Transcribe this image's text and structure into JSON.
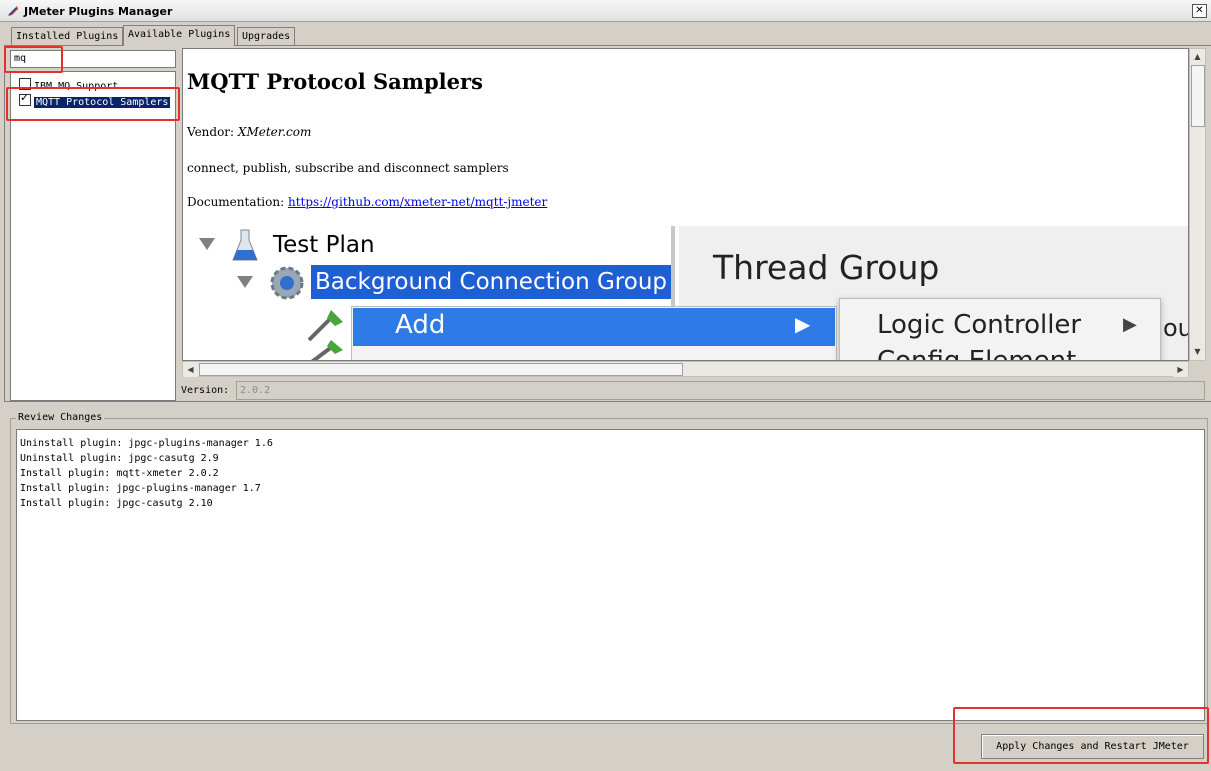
{
  "window": {
    "title": "JMeter Plugins Manager",
    "close_glyph": "✕"
  },
  "tabs": [
    {
      "label": "Installed Plugins",
      "active": false
    },
    {
      "label": "Available Plugins",
      "active": true
    },
    {
      "label": "Upgrades",
      "active": false
    }
  ],
  "search": {
    "value": "mq"
  },
  "plugins": [
    {
      "label": "IBM MQ Support",
      "checked": false,
      "selected": false
    },
    {
      "label": "MQTT Protocol Samplers",
      "checked": true,
      "selected": true
    }
  ],
  "detail": {
    "title": "MQTT Protocol Samplers",
    "vendor_label": "Vendor:",
    "vendor": "XMeter.com",
    "description": "connect, publish, subscribe and disconnect samplers",
    "doc_label": "Documentation:",
    "doc_link": "https://github.com/xmeter-net/mqtt-jmeter"
  },
  "embedded_image": {
    "tree_root": "Test Plan",
    "tree_child": "Background Connection Group",
    "panel_title": "Thread Group",
    "menu_add": "Add",
    "submenu_1": "Logic Controller",
    "submenu_2": "Config Element",
    "partial_text": "oup"
  },
  "version": {
    "label": "Version:",
    "value": "2.0.2"
  },
  "review": {
    "legend": "Review Changes",
    "lines": [
      "Uninstall plugin: jpgc-plugins-manager 1.6",
      "Uninstall plugin: jpgc-casutg 2.9",
      "Install plugin: mqtt-xmeter 2.0.2",
      "Install plugin: jpgc-plugins-manager 1.7",
      "Install plugin: jpgc-casutg 2.10"
    ]
  },
  "apply_button": "Apply Changes and Restart JMeter",
  "colors": {
    "highlight": "#e8302a",
    "selection": "#0a246a",
    "menu_blue": "#2e7ae6"
  }
}
